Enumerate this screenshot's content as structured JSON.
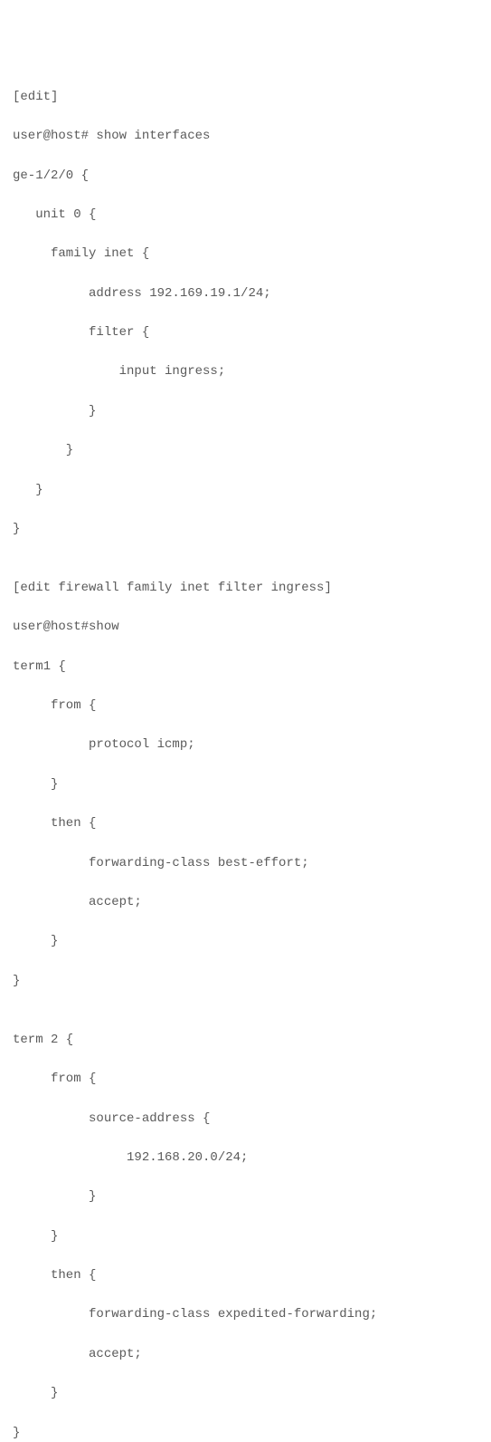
{
  "lines": [
    "[edit]",
    "user@host# show interfaces",
    "ge-1/2/0 {",
    "   unit 0 {",
    "     family inet {",
    "          address 192.169.19.1/24;",
    "          filter {",
    "              input ingress;",
    "          }",
    "       }",
    "   }",
    "}",
    "",
    "[edit firewall family inet filter ingress]",
    "user@host#show",
    "term1 {",
    "     from {",
    "          protocol icmp;",
    "     }",
    "     then {",
    "          forwarding-class best-effort;",
    "          accept;",
    "     }",
    "}",
    "",
    "term 2 {",
    "     from {",
    "          source-address {",
    "               192.168.20.0/24;",
    "          }",
    "     }",
    "     then {",
    "          forwarding-class expedited-forwarding;",
    "          accept;",
    "     }",
    "}"
  ]
}
